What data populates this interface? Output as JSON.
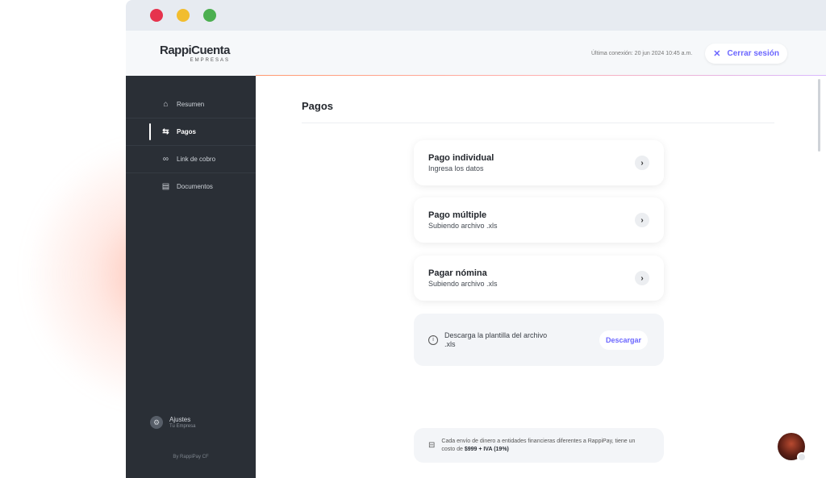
{
  "window": {
    "controls": [
      "close",
      "minimize",
      "maximize"
    ]
  },
  "header": {
    "logo_main": "RappiCuenta",
    "logo_sub": "EMPRESAS",
    "last_connection": "Última conexión: 20 jun 2024 10:45 a.m.",
    "logout_label": "Cerrar sesión",
    "logout_icon": "close-icon"
  },
  "sidebar": {
    "items": [
      {
        "label": "Resumen",
        "icon": "home-icon",
        "active": false
      },
      {
        "label": "Pagos",
        "icon": "transfer-icon",
        "active": true
      },
      {
        "label": "Link de cobro",
        "icon": "link-icon",
        "active": false
      },
      {
        "label": "Documentos",
        "icon": "document-icon",
        "active": false
      }
    ],
    "settings_title": "Ajustes",
    "settings_subtitle": "Tu Empresa",
    "footer": "By RappiPay CF"
  },
  "main": {
    "title": "Pagos",
    "cards": [
      {
        "title": "Pago individual",
        "subtitle": "Ingresa los datos"
      },
      {
        "title": "Pago múltiple",
        "subtitle": "Subiendo archivo .xls"
      },
      {
        "title": "Pagar nómina",
        "subtitle": "Subiendo archivo .xls"
      }
    ],
    "download_text": "Descarga la plantilla del archivo .xls",
    "download_button": "Descargar",
    "notice_text": "Cada envío de dinero a entidades financieras diferentes a RappiPay, tiene un costo de",
    "notice_cost": "$999 + IVA (19%)"
  },
  "colors": {
    "accent": "#6b66ff",
    "sidebar_bg": "#2a2f36"
  }
}
